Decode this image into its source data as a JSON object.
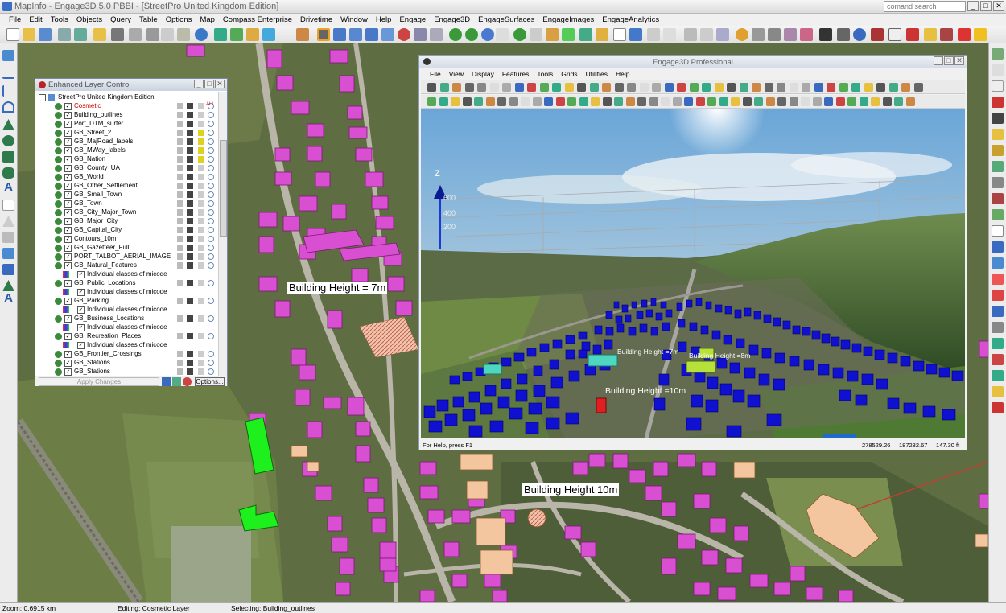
{
  "window": {
    "title": "MapInfo - Engage3D 5.0  PBBI - [StreetPro United Kingdom Edition]",
    "command_placeholder": "comand search"
  },
  "menu": [
    "File",
    "Edit",
    "Tools",
    "Objects",
    "Query",
    "Table",
    "Options",
    "Map",
    "Compass Enterprise",
    "Drivetime",
    "Window",
    "Help",
    "Engage",
    "Engage3D",
    "EngageSurfaces",
    "EngageImages",
    "EngageAnalytics"
  ],
  "status": {
    "zoom": "Zoom: 0.6915 km",
    "editing": "Editing: Cosmetic Layer",
    "selecting": "Selecting: Building_outlines"
  },
  "map_labels": {
    "bh7": "Building Height = 7m",
    "bh10": "Building Height 10m"
  },
  "elc": {
    "title": "Enhanced Layer Control",
    "root": "StreetPro United Kingdom Edition",
    "layers": [
      {
        "name": "Cosmetic",
        "flag": "ALL"
      },
      {
        "name": "Building_outlines"
      },
      {
        "name": "Port_DTM_surfer"
      },
      {
        "name": "GB_Street_2"
      },
      {
        "name": "GB_MajRoad_labels"
      },
      {
        "name": "GB_MWay_labels"
      },
      {
        "name": "GB_Nation"
      },
      {
        "name": "GB_County_UA"
      },
      {
        "name": "GB_World"
      },
      {
        "name": "GB_Other_Settlement"
      },
      {
        "name": "GB_Small_Town"
      },
      {
        "name": "GB_Town"
      },
      {
        "name": "GB_City_Major_Town"
      },
      {
        "name": "GB_Major_City"
      },
      {
        "name": "GB_Capital_City"
      },
      {
        "name": "Contours_10m"
      },
      {
        "name": "GB_Gazetteer_Full"
      },
      {
        "name": "PORT_TALBOT_AERIAL_IMAGE"
      },
      {
        "name": "GB_Natural_Features"
      },
      {
        "name": "Individual classes of micode",
        "sub": true
      },
      {
        "name": "GB_Public_Locations"
      },
      {
        "name": "Individual classes of micode",
        "sub": true
      },
      {
        "name": "GB_Parking"
      },
      {
        "name": "Individual classes of micode",
        "sub": true
      },
      {
        "name": "GB_Business_Locations"
      },
      {
        "name": "Individual classes of micode",
        "sub": true
      },
      {
        "name": "GB_Recreation_Places"
      },
      {
        "name": "Individual classes of micode",
        "sub": true
      },
      {
        "name": "GB_Frontier_Crossings"
      },
      {
        "name": "GB_Stations"
      },
      {
        "name": "GB_Stations"
      }
    ],
    "apply": "Apply Changes",
    "options": "Options..."
  },
  "engage3d": {
    "title": "Engage3D Professional",
    "menu": [
      "File",
      "View",
      "Display",
      "Features",
      "Tools",
      "Grids",
      "Utilities",
      "Help"
    ],
    "axis": {
      "label": "Z",
      "ticks": [
        "600",
        "400",
        "200"
      ]
    },
    "labels": {
      "bh7": "Building Height =7m",
      "bh8": "Building Height =8m",
      "bh10": "Building Height =10m"
    },
    "status": {
      "help": "For Help, press F1",
      "x": "278529.26",
      "y": "187282.67",
      "z": "147.30 ft"
    }
  },
  "colors": {
    "building": "#d94fd1",
    "building3d": "#1010d0",
    "selected": "#e02020",
    "highlight": "#b6e03a",
    "teal": "#4fd6c0"
  }
}
